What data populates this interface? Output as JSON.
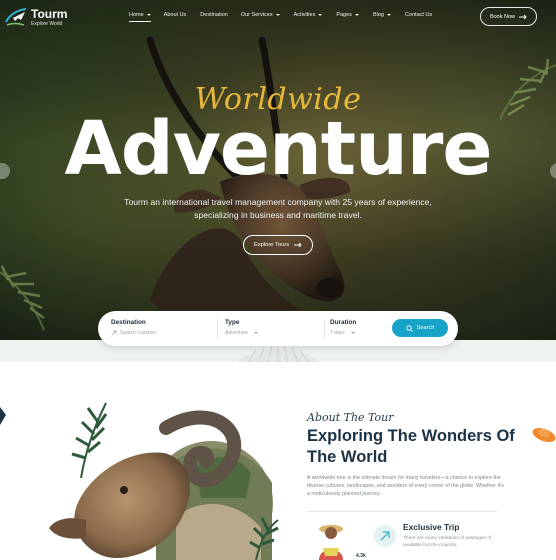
{
  "brand": {
    "name": "Tourm",
    "tagline": "Explore World"
  },
  "nav": {
    "items": [
      {
        "label": "Home",
        "dropdown": true,
        "active": true
      },
      {
        "label": "About Us",
        "dropdown": false
      },
      {
        "label": "Destination",
        "dropdown": false
      },
      {
        "label": "Our Services",
        "dropdown": true
      },
      {
        "label": "Activities",
        "dropdown": true
      },
      {
        "label": "Pages",
        "dropdown": true
      },
      {
        "label": "Blog",
        "dropdown": true
      },
      {
        "label": "Contact Us",
        "dropdown": false
      }
    ],
    "book_label": "Book Now"
  },
  "hero": {
    "script": "Worldwide",
    "headline": "Adventure",
    "description": "Tourm an international travel management company with 25 years of experience, specializing in business and maritime travel.",
    "cta_label": "Explore Tours"
  },
  "search": {
    "destination": {
      "label": "Destination",
      "placeholder": "Search Loaction"
    },
    "type": {
      "label": "Type",
      "value": "Adventure"
    },
    "duration": {
      "label": "Duration",
      "value": "7 days"
    },
    "button_label": "Search"
  },
  "about": {
    "kicker": "About The Tour",
    "title": "Exploring The Wonders Of The World",
    "description": "A worldwide tour is the ultimate dream for many travelers—a chance to explore the diverse cultures, landscapes, and wonders of every corner of the globe. Whether it's a meticulously planned journey.",
    "traveler_count": "4.3k",
    "feature": {
      "title": "Exclusive Trip",
      "description": "There are many variations of passages of available but the majority."
    }
  },
  "colors": {
    "accent": "#16a3c7",
    "script_gold": "#e7b73a",
    "heading_dark": "#1d3346",
    "band": "#eef3f0"
  },
  "icons": {
    "arrow": "arrow-right-icon",
    "location": "location-pin-icon",
    "search": "search-icon",
    "plane": "plane-icon",
    "caret": "chevron-down-icon"
  }
}
